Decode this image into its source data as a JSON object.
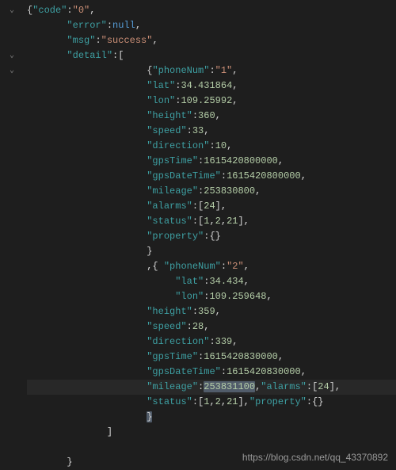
{
  "watermark": "https://blog.csdn.net/qq_43370892",
  "indent": {
    "l0": "",
    "l2": "       ",
    "l4": "              ",
    "l5": "                     ",
    "l6": "                      ",
    "l7": "                          "
  },
  "tok": {
    "open_brace": "{",
    "close_brace": "}",
    "open_bracket": "[",
    "close_bracket": "]",
    "quote": "\"",
    "colon": ":",
    "comma": ",",
    "brace_comma": "},",
    "comma_brace": ",{ ",
    "space": " "
  },
  "keys": {
    "code": "\"code\"",
    "error": "\"error\"",
    "msg": "\"msg\"",
    "detail": "\"detail\"",
    "phoneNum": "\"phoneNum\"",
    "lat": "\"lat\"",
    "lon": "\"lon\"",
    "height": "\"height\"",
    "speed": "\"speed\"",
    "direction": "\"direction\"",
    "gpsTime": "\"gpsTime\"",
    "gpsDateTime": "\"gpsDateTime\"",
    "mileage": "\"mileage\"",
    "alarms": "\"alarms\"",
    "status": "\"status\"",
    "property": "\"property\""
  },
  "vals": {
    "code": "\"0\"",
    "error": "null",
    "msg": "\"success\"",
    "phone1": "\"1\"",
    "lat1": "34.431864",
    "lon1": "109.25992",
    "height1": "360",
    "speed1": "33",
    "direction1": "10",
    "gpsTime1": "1615420800000",
    "gpsDateTime1": "1615420800000",
    "mileage1": "253830800",
    "alarms1": "24",
    "status1a": "1",
    "status1b": "2",
    "status1c": "21",
    "phone2": "\"2\"",
    "lat2": "34.434",
    "lon2": "109.259648",
    "height2": "359",
    "speed2": "28",
    "direction2": "339",
    "gpsTime2": "1615420830000",
    "gpsDateTime2": "1615420830000",
    "mileage2": "253831100",
    "alarms2": "24",
    "status2a": "1",
    "status2b": "2",
    "status2c": "21"
  },
  "fold_icon": "⌄"
}
